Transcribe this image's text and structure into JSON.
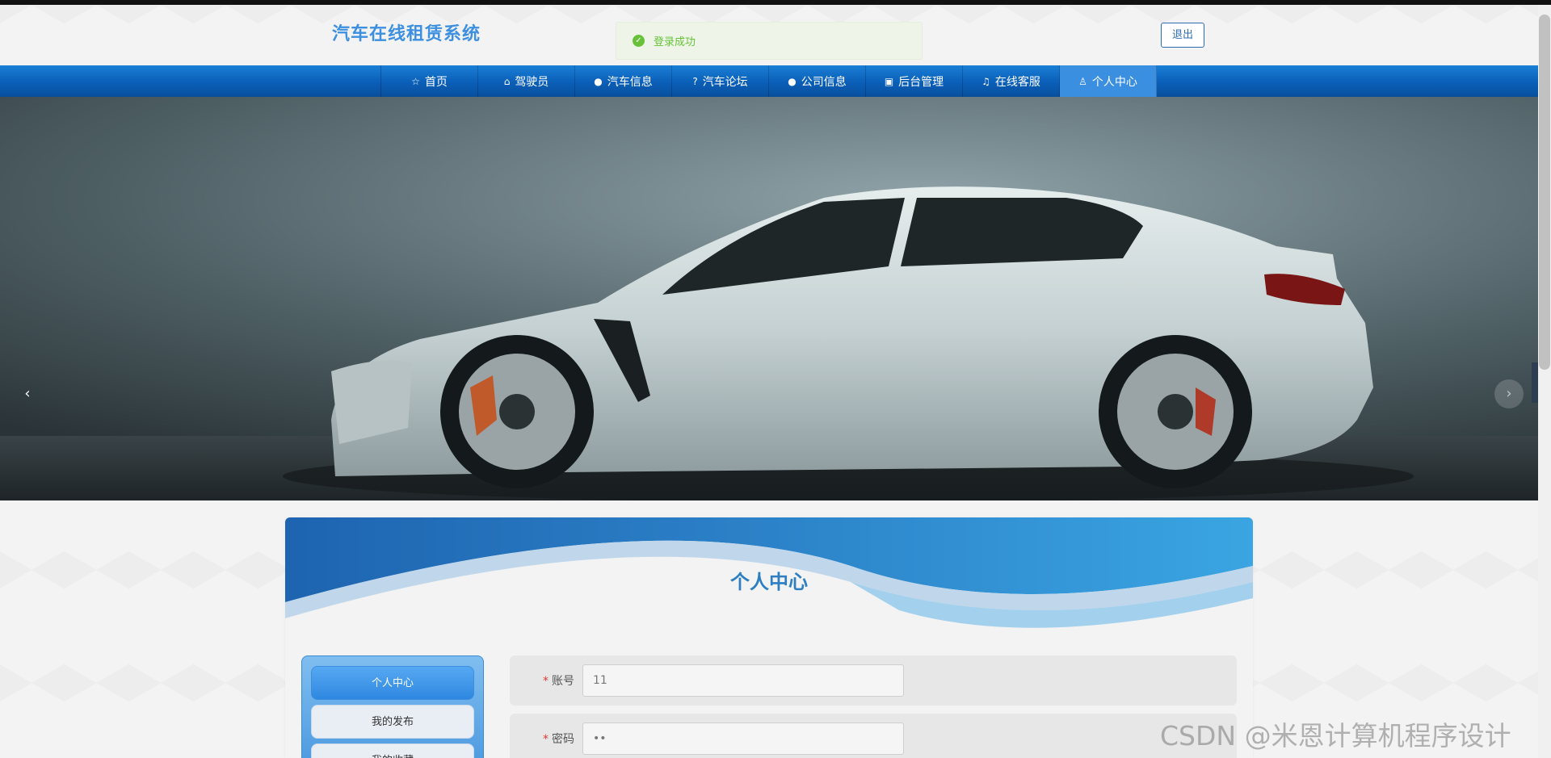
{
  "header": {
    "site_title": "汽车在线租赁系统",
    "logout_label": "退出",
    "toast": {
      "message": "登录成功",
      "icon": "check-circle-icon",
      "color": "#67c23a"
    }
  },
  "nav": {
    "items": [
      {
        "label": "首页",
        "icon": "star-icon"
      },
      {
        "label": "驾驶员",
        "icon": "bag-icon"
      },
      {
        "label": "汽车信息",
        "icon": "info-icon"
      },
      {
        "label": "汽车论坛",
        "icon": "question-icon"
      },
      {
        "label": "公司信息",
        "icon": "info-icon"
      },
      {
        "label": "后台管理",
        "icon": "building-icon"
      },
      {
        "label": "在线客服",
        "icon": "headset-icon"
      },
      {
        "label": "个人中心",
        "icon": "user-icon"
      }
    ],
    "active": "个人中心",
    "accent": "#0b5fb8"
  },
  "carousel": {
    "slide_count": 3,
    "active_slide": 1,
    "prev_icon": "chevron-left-icon",
    "next_icon": "chevron-right-icon"
  },
  "panel": {
    "title": "个人中心",
    "menu": [
      {
        "label": "个人中心"
      },
      {
        "label": "我的发布"
      },
      {
        "label": "我的收藏"
      }
    ],
    "fields": [
      {
        "label": "账号",
        "value": "11",
        "required": true
      },
      {
        "label": "密码",
        "value": "••",
        "required": true
      }
    ]
  },
  "watermark": "CSDN @米恩计算机程序设计"
}
